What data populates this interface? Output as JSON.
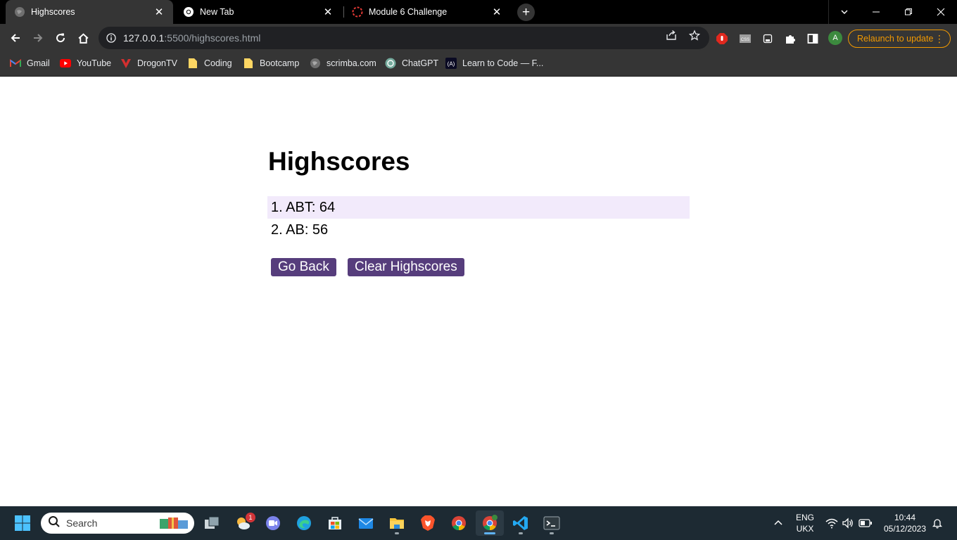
{
  "browser": {
    "tabs": [
      {
        "title": "Highscores",
        "active": true,
        "favicon": "globe-icon"
      },
      {
        "title": "New Tab",
        "active": false,
        "favicon": "chrome-icon"
      },
      {
        "title": "Module 6 Challenge",
        "active": false,
        "favicon": "dashed-circle-icon"
      }
    ],
    "url_host": "127.0.0.1",
    "url_path": ":5500/highscores.html",
    "relaunch_label": "Relaunch to update",
    "profile_initial": "A",
    "bookmarks": [
      {
        "label": "Gmail",
        "icon": "gmail-icon"
      },
      {
        "label": "YouTube",
        "icon": "youtube-icon"
      },
      {
        "label": "DrogonTV",
        "icon": "drogontv-icon"
      },
      {
        "label": "Coding",
        "icon": "folder-icon"
      },
      {
        "label": "Bootcamp",
        "icon": "folder-icon"
      },
      {
        "label": "scrimba.com",
        "icon": "scrimba-icon"
      },
      {
        "label": "ChatGPT",
        "icon": "chatgpt-icon"
      },
      {
        "label": "Learn to Code — F...",
        "icon": "freecodecamp-icon"
      }
    ]
  },
  "page": {
    "title": "Highscores",
    "scores": [
      "1. ABT: 64",
      "2. AB: 56"
    ],
    "go_back_label": "Go Back",
    "clear_label": "Clear Highscores",
    "accent_color": "#563d7c",
    "row_highlight_color": "#f2eafb"
  },
  "taskbar": {
    "search_label": "Search",
    "notification_count": "1",
    "language": "ENG",
    "layout": "UKX",
    "time": "10:44",
    "date": "05/12/2023"
  }
}
